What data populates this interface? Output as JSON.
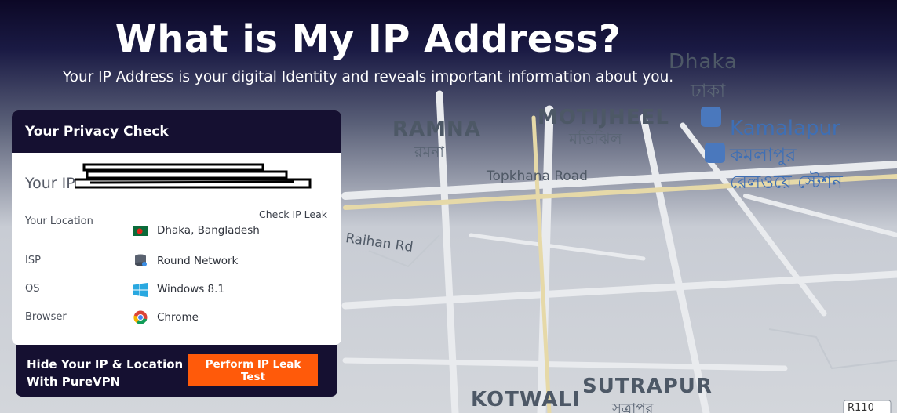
{
  "header": {
    "title": "What is My IP Address?",
    "subtitle": "Your IP Address is your digital Identity and reveals important information about you."
  },
  "map": {
    "labels": {
      "dhaka": "Dhaka",
      "dhaka_bn": "ঢাকা",
      "ramna": "RAMNA",
      "ramna_bn": "রমনা",
      "motijheel": "MOTIJHEEL",
      "motijheel_bn": "মতিঝিল",
      "kamalapur": "Kamalapur",
      "kamalapur_bn1": "কমলাপুর",
      "kamalapur_bn2": "রেলওয়ে স্টেশন",
      "topkhana": "Topkhana Road",
      "raihan": "Raihan Rd",
      "kotwali": "KOTWALI",
      "sutrapur": "SUTRAPUR",
      "sutrapur_bn": "সূত্রাপুর",
      "road_code": "R110"
    }
  },
  "privacy_card": {
    "title": "Your Privacy Check",
    "ip_label": "Your IP",
    "check_link": "Check IP Leak",
    "rows": [
      {
        "label": "Your Location",
        "value": "Dhaka, Bangladesh",
        "icon": "bangladesh-flag-icon"
      },
      {
        "label": "ISP",
        "value": "Round Network",
        "icon": "database-icon"
      },
      {
        "label": "OS",
        "value": "Windows 8.1",
        "icon": "windows-icon"
      },
      {
        "label": "Browser",
        "value": "Chrome",
        "icon": "chrome-icon"
      }
    ]
  },
  "cta": {
    "text_line1": "Hide Your IP & Location",
    "text_line2": "With PureVPN",
    "button": "Perform IP Leak Test"
  },
  "colors": {
    "card_header": "#151031",
    "button": "#ff5a0a"
  }
}
